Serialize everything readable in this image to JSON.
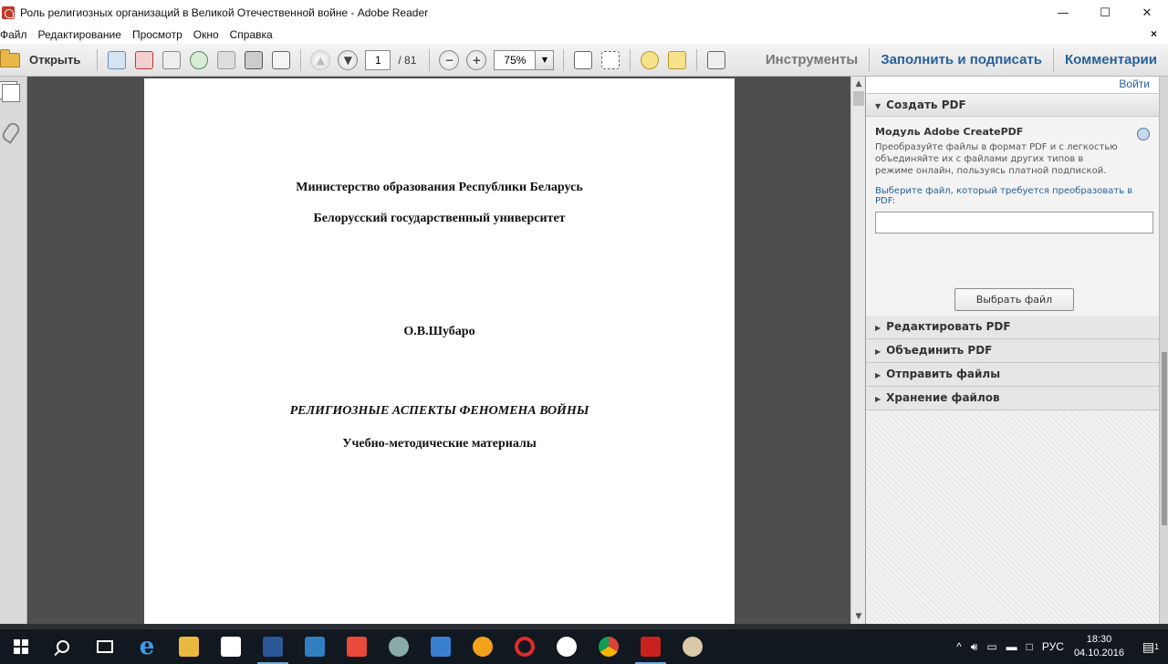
{
  "window": {
    "title": "Роль религиозных организаций в Великой Отечественной войне - Adobe Reader",
    "minimize": "—",
    "maximize": "☐",
    "close": "✕"
  },
  "menu": {
    "items": [
      "Файл",
      "Редактирование",
      "Просмотр",
      "Окно",
      "Справка"
    ],
    "close_doc": "×"
  },
  "toolbar": {
    "open_label": "Открыть",
    "page_current": "1",
    "page_total": "/ 81",
    "zoom": "75%",
    "tabs": {
      "tools": "Инструменты",
      "fill_sign": "Заполнить и подписать",
      "comments": "Комментарии"
    }
  },
  "document": {
    "lines": [
      "Министерство образования Республики Беларусь",
      "Белорусский государственный  университет",
      "О.В.Шубаро",
      "РЕЛИГИОЗНЫЕ АСПЕКТЫ ФЕНОМЕНА ВОЙНЫ",
      "Учебно-методические материалы"
    ]
  },
  "right_pane": {
    "login": "Войти",
    "create_pdf": {
      "header": "Создать PDF",
      "module_title": "Модуль Adobe CreatePDF",
      "module_desc": "Преобразуйте файлы в формат PDF и с легкостью объединяйте их с файлами других типов в режиме онлайн, пользуясь платной подпиской.",
      "choose_label": "Выберите файл, который требуется преобразовать в PDF:",
      "file_value": "",
      "choose_button": "Выбрать файл"
    },
    "sections": [
      "Редактировать PDF",
      "Объединить PDF",
      "Отправить файлы",
      "Хранение файлов"
    ]
  },
  "taskbar": {
    "tray_lang": "РУС",
    "time": "18:30",
    "date": "04.10.2016",
    "notif_count": "1"
  }
}
